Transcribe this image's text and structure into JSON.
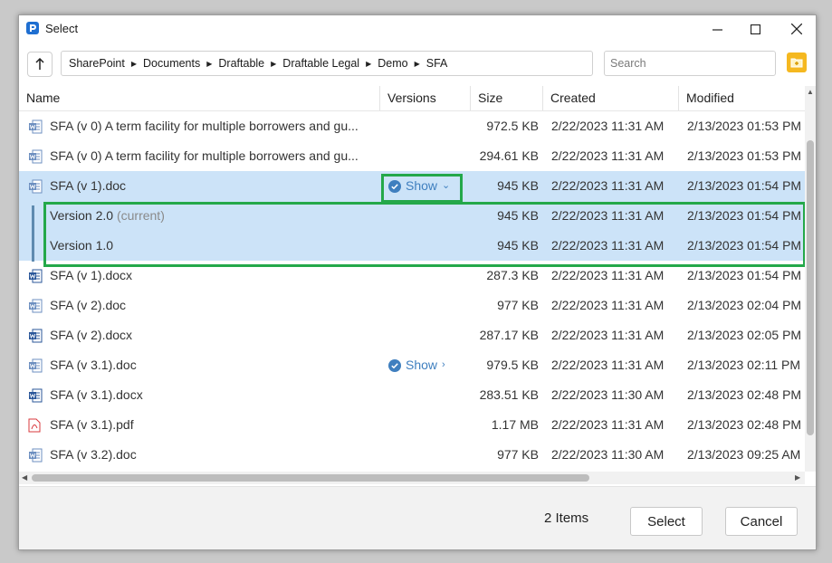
{
  "window": {
    "title": "Select"
  },
  "breadcrumb": [
    "SharePoint",
    "Documents",
    "Draftable",
    "Draftable Legal",
    "Demo",
    "SFA"
  ],
  "search": {
    "placeholder": "Search"
  },
  "columns": {
    "name": "Name",
    "versions": "Versions",
    "size": "Size",
    "created": "Created",
    "modified": "Modified"
  },
  "rows": [
    {
      "icon": "word-doc-icon",
      "name": "SFA (v 0) A term facility for multiple borrowers and gu...",
      "versions": "",
      "size": "972.5 KB",
      "created": "2/22/2023 11:31 AM",
      "modified": "2/13/2023 01:53 PM"
    },
    {
      "icon": "word-doc-icon",
      "name": "SFA (v 0) A term facility for multiple borrowers and gu...",
      "versions": "",
      "size": "294.61 KB",
      "created": "2/22/2023 11:31 AM",
      "modified": "2/13/2023 01:53 PM"
    },
    {
      "icon": "word-doc-icon",
      "name": "SFA (v 1).doc",
      "versions": "Show",
      "size": "945 KB",
      "created": "2/22/2023 11:31 AM",
      "modified": "2/13/2023 01:54 PM",
      "selected": true,
      "expanded": true
    },
    {
      "icon": "word-docx-icon",
      "name": "SFA (v 1).docx",
      "versions": "",
      "size": "287.3 KB",
      "created": "2/22/2023 11:31 AM",
      "modified": "2/13/2023 01:54 PM"
    },
    {
      "icon": "word-doc-icon",
      "name": "SFA (v 2).doc",
      "versions": "",
      "size": "977 KB",
      "created": "2/22/2023 11:31 AM",
      "modified": "2/13/2023 02:04 PM"
    },
    {
      "icon": "word-docx-icon",
      "name": "SFA (v 2).docx",
      "versions": "",
      "size": "287.17 KB",
      "created": "2/22/2023 11:31 AM",
      "modified": "2/13/2023 02:05 PM"
    },
    {
      "icon": "word-doc-icon",
      "name": "SFA (v 3.1).doc",
      "versions": "Show",
      "size": "979.5 KB",
      "created": "2/22/2023 11:31 AM",
      "modified": "2/13/2023 02:11 PM"
    },
    {
      "icon": "word-docx-icon",
      "name": "SFA (v 3.1).docx",
      "versions": "",
      "size": "283.51 KB",
      "created": "2/22/2023 11:30 AM",
      "modified": "2/13/2023 02:48 PM"
    },
    {
      "icon": "pdf-icon",
      "name": "SFA (v 3.1).pdf",
      "versions": "",
      "size": "1.17 MB",
      "created": "2/22/2023 11:31 AM",
      "modified": "2/13/2023 02:48 PM"
    },
    {
      "icon": "word-doc-icon",
      "name": "SFA (v 3.2).doc",
      "versions": "",
      "size": "977 KB",
      "created": "2/22/2023 11:30 AM",
      "modified": "2/13/2023 09:25 AM"
    }
  ],
  "versions": [
    {
      "label": "Version 2.0",
      "tag": "(current)",
      "size": "945 KB",
      "created": "2/22/2023 11:31 AM",
      "modified": "2/13/2023 01:54 PM"
    },
    {
      "label": "Version 1.0",
      "tag": "",
      "size": "945 KB",
      "created": "2/22/2023 11:31 AM",
      "modified": "2/13/2023 01:54 PM"
    }
  ],
  "footer": {
    "count": "2 Items",
    "select_label": "Select",
    "cancel_label": "Cancel"
  },
  "colors": {
    "accent": "#3f7fbf",
    "selection": "#cce3f8",
    "highlight": "#24a84a",
    "word": "#2b579a",
    "pdf": "#d9393e"
  }
}
